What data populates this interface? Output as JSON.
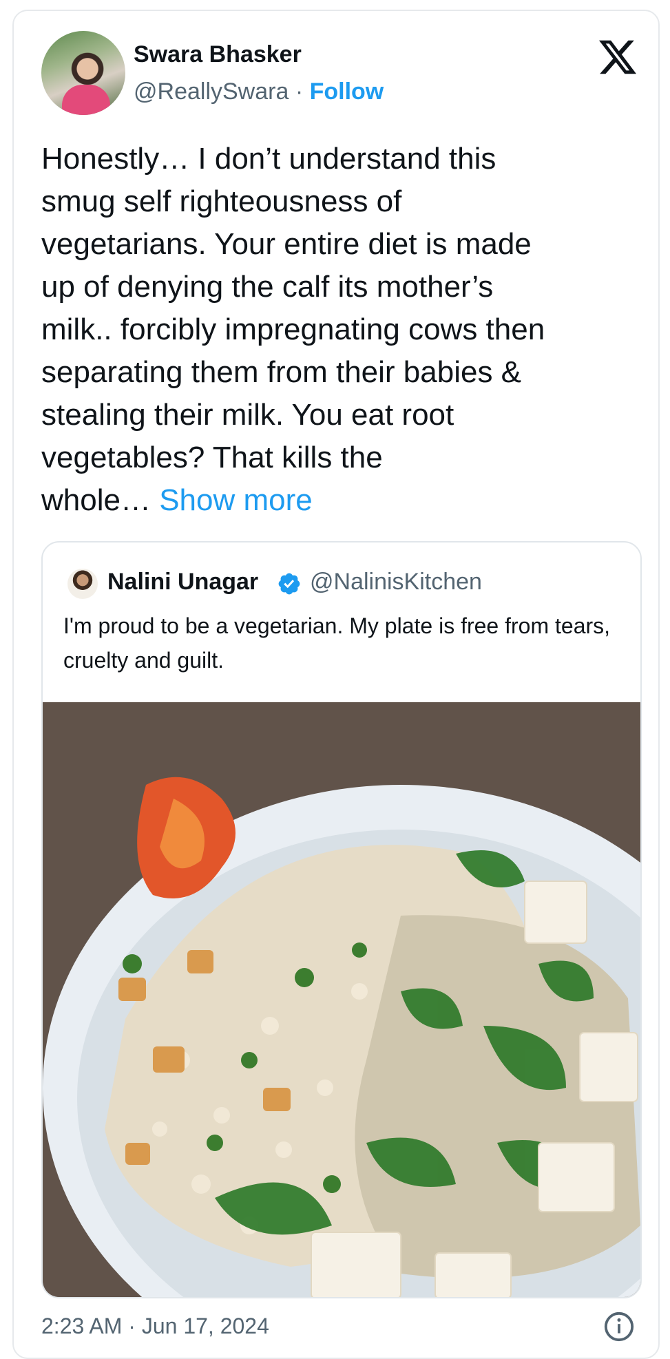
{
  "author": {
    "name": "Swara Bhasker",
    "handle": "@ReallySwara",
    "separator": "·",
    "follow_label": "Follow"
  },
  "tweet": {
    "text": "Honestly… I don’t understand this\nsmug self righteousness of\nvegetarians. Your entire diet is made\nup of denying the calf its mother’s\nmilk.. forcibly impregnating cows then\nseparating them from their babies &\nstealing their milk. You eat root\nvegetables? That kills the\nwhole…",
    "show_more": "Show more",
    "timestamp": "2:23 AM · Jun 17, 2024"
  },
  "quoted": {
    "name": "Nalini Unagar",
    "handle": "@NalinisKitchen",
    "text": "I'm proud to be a vegetarian. My plate is free from tears, cruelty and guilt."
  },
  "icons": {
    "brand": "x-logo-icon",
    "verified": "verified-badge-icon",
    "info": "info-icon"
  },
  "colors": {
    "link": "#1d9bf0",
    "secondary_text": "#536471",
    "verified": "#1d9bf0"
  }
}
